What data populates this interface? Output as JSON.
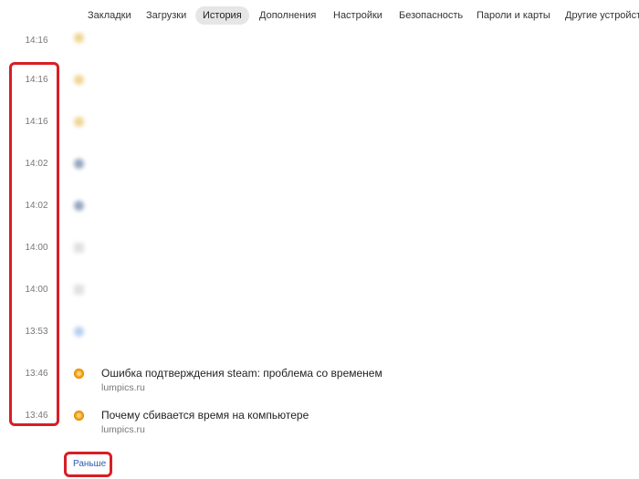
{
  "nav": {
    "tabs": [
      {
        "label": "Закладки",
        "active": false
      },
      {
        "label": "Загрузки",
        "active": false
      },
      {
        "label": "История",
        "active": true
      },
      {
        "label": "Дополнения",
        "active": false
      },
      {
        "label": "Настройки",
        "active": false
      },
      {
        "label": "Безопасность",
        "active": false
      },
      {
        "label": "Пароли и карты",
        "active": false
      },
      {
        "label": "Другие устройства",
        "active": false
      }
    ]
  },
  "history": {
    "entries": [
      {
        "time": "14:16",
        "title": "",
        "domain": "",
        "icon": "yellow",
        "blurred": true
      },
      {
        "time": "14:16",
        "title": "",
        "domain": "",
        "icon": "yellow",
        "blurred": true
      },
      {
        "time": "14:16",
        "title": "",
        "domain": "",
        "icon": "yellow",
        "blurred": true
      },
      {
        "time": "14:02",
        "title": "",
        "domain": "",
        "icon": "steam",
        "blurred": true
      },
      {
        "time": "14:02",
        "title": "",
        "domain": "",
        "icon": "steam",
        "blurred": true
      },
      {
        "time": "14:00",
        "title": "",
        "domain": "",
        "icon": "gray",
        "blurred": true
      },
      {
        "time": "14:00",
        "title": "",
        "domain": "",
        "icon": "gray",
        "blurred": true
      },
      {
        "time": "13:53",
        "title": "",
        "domain": "",
        "icon": "google",
        "blurred": true
      },
      {
        "time": "13:46",
        "title": "Ошибка подтверждения steam: проблема со временем",
        "domain": "lumpics.ru",
        "icon": "orange",
        "blurred": false
      },
      {
        "time": "13:46",
        "title": "Почему сбивается время на компьютере",
        "domain": "lumpics.ru",
        "icon": "orange",
        "blurred": false
      }
    ],
    "earlier_label": "Раньше"
  },
  "colors": {
    "highlight": "#d81e24",
    "link": "#2a5db0",
    "active_tab_bg": "#e6e6e6"
  }
}
